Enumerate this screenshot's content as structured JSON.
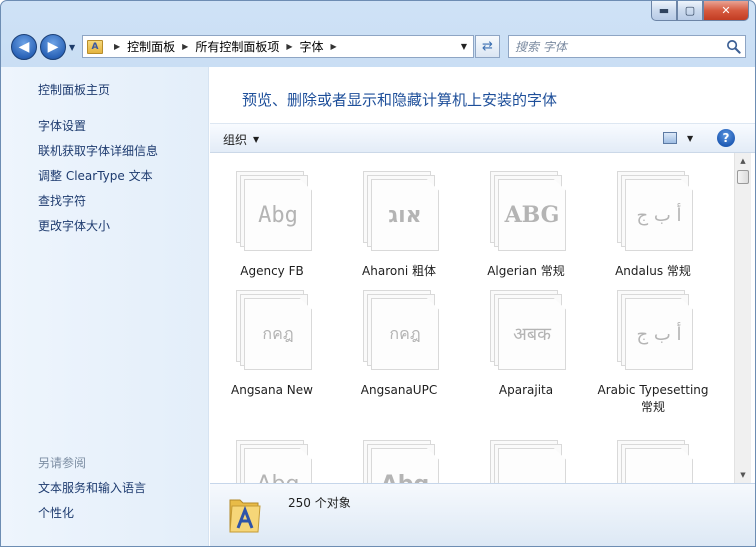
{
  "window": {
    "caption_buttons": {
      "minimize": "▬",
      "maximize": "▢",
      "close": "✕"
    }
  },
  "navigation": {
    "back_glyph": "◀",
    "forward_glyph": "▶",
    "breadcrumbs": [
      "控制面板",
      "所有控制面板项",
      "字体"
    ],
    "search_placeholder": "搜索 字体"
  },
  "sidebar": {
    "home_link": "控制面板主页",
    "links": [
      "字体设置",
      "联机获取字体详细信息",
      "调整 ClearType 文本",
      "查找字符",
      "更改字体大小"
    ],
    "see_also_heading": "另请参阅",
    "see_also_links": [
      "文本服务和输入语言",
      "个性化"
    ]
  },
  "main": {
    "title": "预览、删除或者显示和隐藏计算机上安装的字体",
    "organize_label": "组织",
    "help_label": "?"
  },
  "fonts": [
    {
      "label": "Agency FB",
      "sample": "Abg"
    },
    {
      "label": "Aharoni 粗体",
      "sample": "אוג"
    },
    {
      "label": "Algerian 常规",
      "sample": "ABG"
    },
    {
      "label": "Andalus 常规",
      "sample": "أ ب ج"
    },
    {
      "label": "Angsana New",
      "sample": "กคฎ"
    },
    {
      "label": "AngsanaUPC",
      "sample": "กคฎ"
    },
    {
      "label": "Aparajita",
      "sample": "अबक"
    },
    {
      "label": "Arabic Typesetting 常规",
      "sample": "أ ب ج"
    },
    {
      "label": "",
      "sample": "Abg"
    },
    {
      "label": "",
      "sample": "Abg"
    },
    {
      "label": "",
      "sample": ""
    },
    {
      "label": "",
      "sample": ""
    }
  ],
  "status": {
    "count_text": "250 个对象"
  },
  "colors": {
    "link": "#1e3b6f",
    "title": "#1e4f9a",
    "frame": "#bcd5f0"
  }
}
